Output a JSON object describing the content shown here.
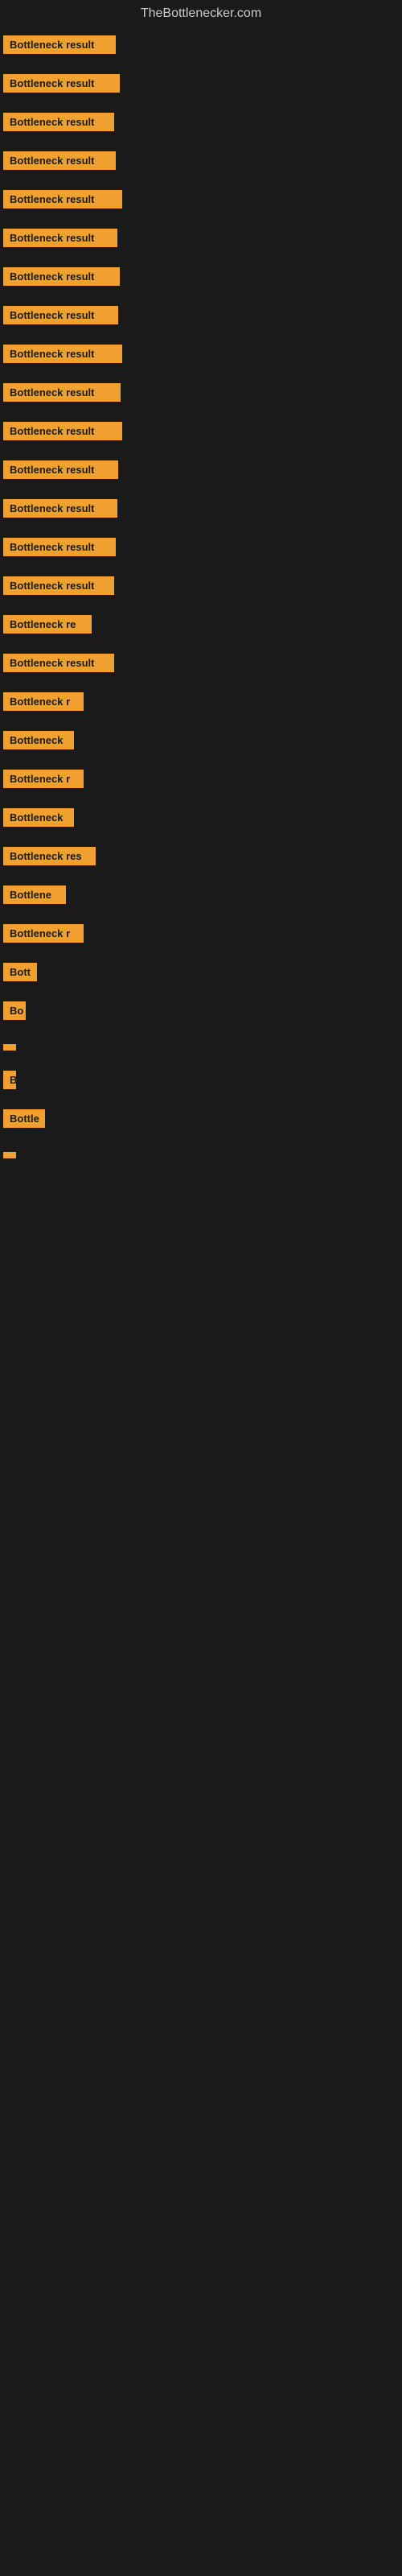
{
  "site": {
    "title": "TheBottlenecker.com"
  },
  "bars": [
    {
      "label": "Bottleneck result",
      "width": 140
    },
    {
      "label": "Bottleneck result",
      "width": 145
    },
    {
      "label": "Bottleneck result",
      "width": 138
    },
    {
      "label": "Bottleneck result",
      "width": 140
    },
    {
      "label": "Bottleneck result",
      "width": 148
    },
    {
      "label": "Bottleneck result",
      "width": 142
    },
    {
      "label": "Bottleneck result",
      "width": 145
    },
    {
      "label": "Bottleneck result",
      "width": 143
    },
    {
      "label": "Bottleneck result",
      "width": 148
    },
    {
      "label": "Bottleneck result",
      "width": 146
    },
    {
      "label": "Bottleneck result",
      "width": 148
    },
    {
      "label": "Bottleneck result",
      "width": 143
    },
    {
      "label": "Bottleneck result",
      "width": 142
    },
    {
      "label": "Bottleneck result",
      "width": 140
    },
    {
      "label": "Bottleneck result",
      "width": 138
    },
    {
      "label": "Bottleneck re",
      "width": 110
    },
    {
      "label": "Bottleneck result",
      "width": 138
    },
    {
      "label": "Bottleneck r",
      "width": 100
    },
    {
      "label": "Bottleneck",
      "width": 88
    },
    {
      "label": "Bottleneck r",
      "width": 100
    },
    {
      "label": "Bottleneck",
      "width": 88
    },
    {
      "label": "Bottleneck res",
      "width": 115
    },
    {
      "label": "Bottlene",
      "width": 78
    },
    {
      "label": "Bottleneck r",
      "width": 100
    },
    {
      "label": "Bott",
      "width": 42
    },
    {
      "label": "Bo",
      "width": 28
    },
    {
      "label": "",
      "width": 8
    },
    {
      "label": "B",
      "width": 16
    },
    {
      "label": "Bottle",
      "width": 52
    },
    {
      "label": "",
      "width": 8
    }
  ]
}
